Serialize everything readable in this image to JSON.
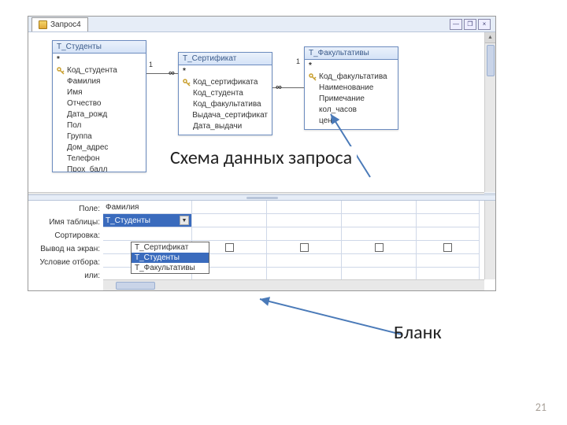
{
  "tab": {
    "title": "Запрос4"
  },
  "window": {
    "min": "—",
    "max": "❐",
    "close": "×"
  },
  "entities": {
    "students": {
      "title": "Т_Студенты",
      "fields": [
        "Код_студента",
        "Фамилия",
        "Имя",
        "Отчество",
        "Дата_рожд",
        "Пол",
        "Группа",
        "Дом_адрес",
        "Телефон",
        "Прох_балл"
      ]
    },
    "cert": {
      "title": "Т_Сертификат",
      "fields": [
        "Код_сертификата",
        "Код_студента",
        "Код_факультатива",
        "Выдача_сертификат",
        "Дата_выдачи"
      ]
    },
    "fac": {
      "title": "Т_Факультативы",
      "fields": [
        "Код_факультатива",
        "Наименование",
        "Примечание",
        "кол_часов",
        "цена"
      ]
    }
  },
  "relation": {
    "one": "1",
    "many": "∞"
  },
  "captions": {
    "schema": "Схема данных запроса",
    "blank": "Бланк"
  },
  "gridLabels": {
    "field": "Поле:",
    "table": "Имя таблицы:",
    "sort": "Сортировка:",
    "show": "Вывод на экран:",
    "cond": "Условие отбора:",
    "or": "или:"
  },
  "gridCol": {
    "field": "Фамилия",
    "table": "Т_Студенты"
  },
  "dropdown": {
    "opt1": "Т_Сертификат",
    "opt2": "Т_Студенты",
    "opt3": "Т_Факультативы"
  },
  "page": "21"
}
